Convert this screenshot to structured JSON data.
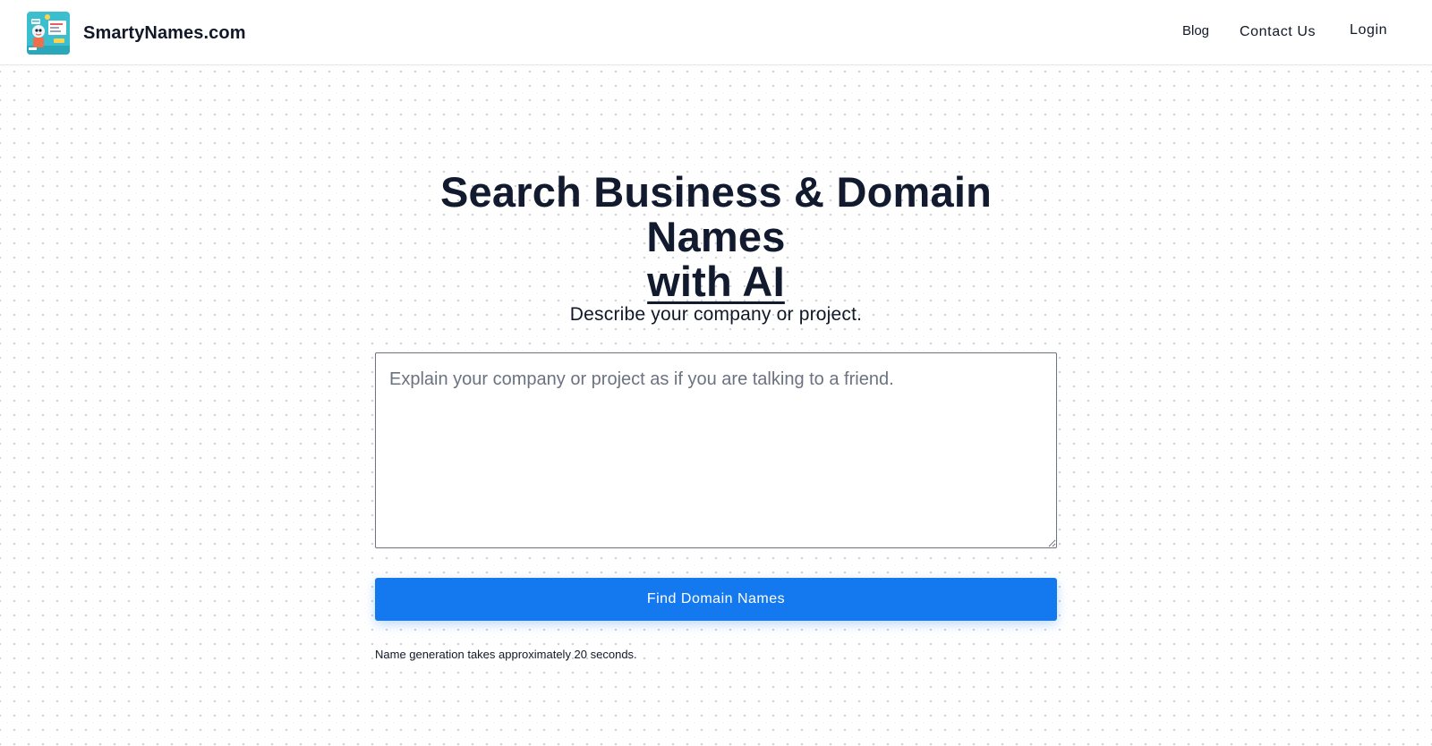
{
  "header": {
    "brand": "SmartyNames.com",
    "logo_icon": "robot-mascot-logo-icon",
    "nav": {
      "blog": "Blog",
      "contact": "Contact Us",
      "login": "Login"
    }
  },
  "hero": {
    "title_line1": "Search Business & Domain Names",
    "title_line2": "with AI",
    "subtitle": "Describe your company or project."
  },
  "form": {
    "description_value": "",
    "description_placeholder": "Explain your company or project as if you are talking to a friend.",
    "submit_label": "Find Domain Names",
    "note": "Name generation takes approximately 20 seconds."
  },
  "colors": {
    "accent": "#1479ef",
    "heading": "#111a2e",
    "logo_bg": "#3bbfcf"
  }
}
